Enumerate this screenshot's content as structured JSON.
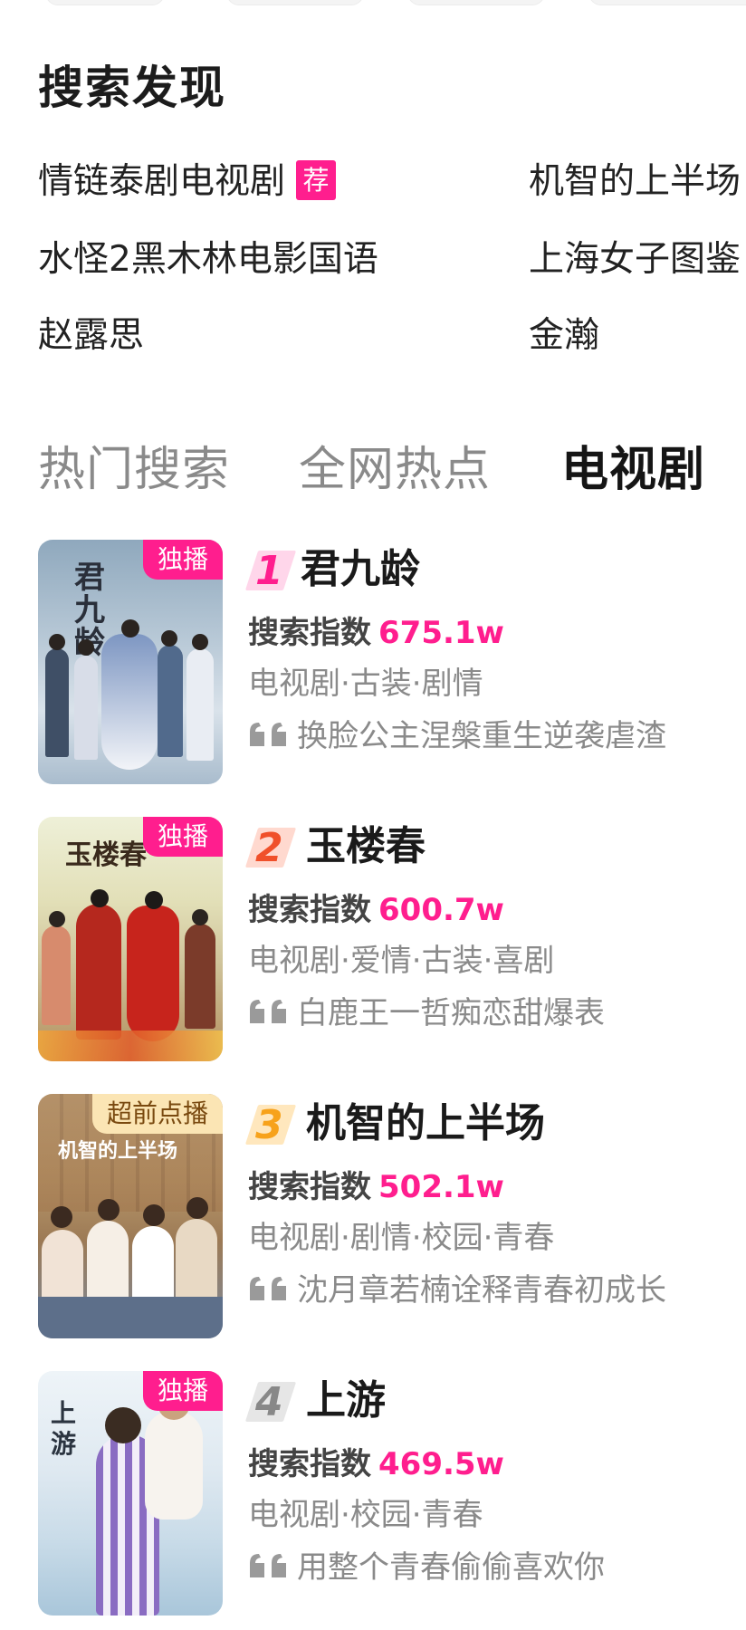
{
  "discover": {
    "title": "搜索发现",
    "items": [
      {
        "text": "情链泰剧电视剧",
        "badge": "荐"
      },
      {
        "text": "机智的上半场"
      },
      {
        "text": "水怪2黑木林电影国语"
      },
      {
        "text": "上海女子图鉴"
      },
      {
        "text": "赵露思"
      },
      {
        "text": "金瀚"
      }
    ]
  },
  "tabs": [
    {
      "label": "热门搜索",
      "active": false
    },
    {
      "label": "全网热点",
      "active": false
    },
    {
      "label": "电视剧",
      "active": true
    }
  ],
  "colors": {
    "accent": "#ff1e8e",
    "rank1": "#ff1e8e",
    "rank2": "#f0502a",
    "rank3": "#f7a21b",
    "rank4": "#888888"
  },
  "list": [
    {
      "rank": "1",
      "title": "君九龄",
      "tag": "独播",
      "index_label": "搜索指数",
      "index_value": "675.1w",
      "genre": "电视剧·古装·剧情",
      "quote": "换脸公主涅槃重生逆袭虐渣",
      "poster_text": "君九龄"
    },
    {
      "rank": "2",
      "title": "玉楼春",
      "tag": "独播",
      "index_label": "搜索指数",
      "index_value": "600.7w",
      "genre": "电视剧·爱情·古装·喜剧",
      "quote": "白鹿王一哲痴恋甜爆表",
      "poster_text": "玉楼春"
    },
    {
      "rank": "3",
      "title": "机智的上半场",
      "tag": "超前点播",
      "index_label": "搜索指数",
      "index_value": "502.1w",
      "genre": "电视剧·剧情·校园·青春",
      "quote": "沈月章若楠诠释青春初成长",
      "poster_text": "机智的上半场"
    },
    {
      "rank": "4",
      "title": "上游",
      "tag": "独播",
      "index_label": "搜索指数",
      "index_value": "469.5w",
      "genre": "电视剧·校园·青春",
      "quote": "用整个青春偷偷喜欢你",
      "poster_text": "上游"
    }
  ]
}
